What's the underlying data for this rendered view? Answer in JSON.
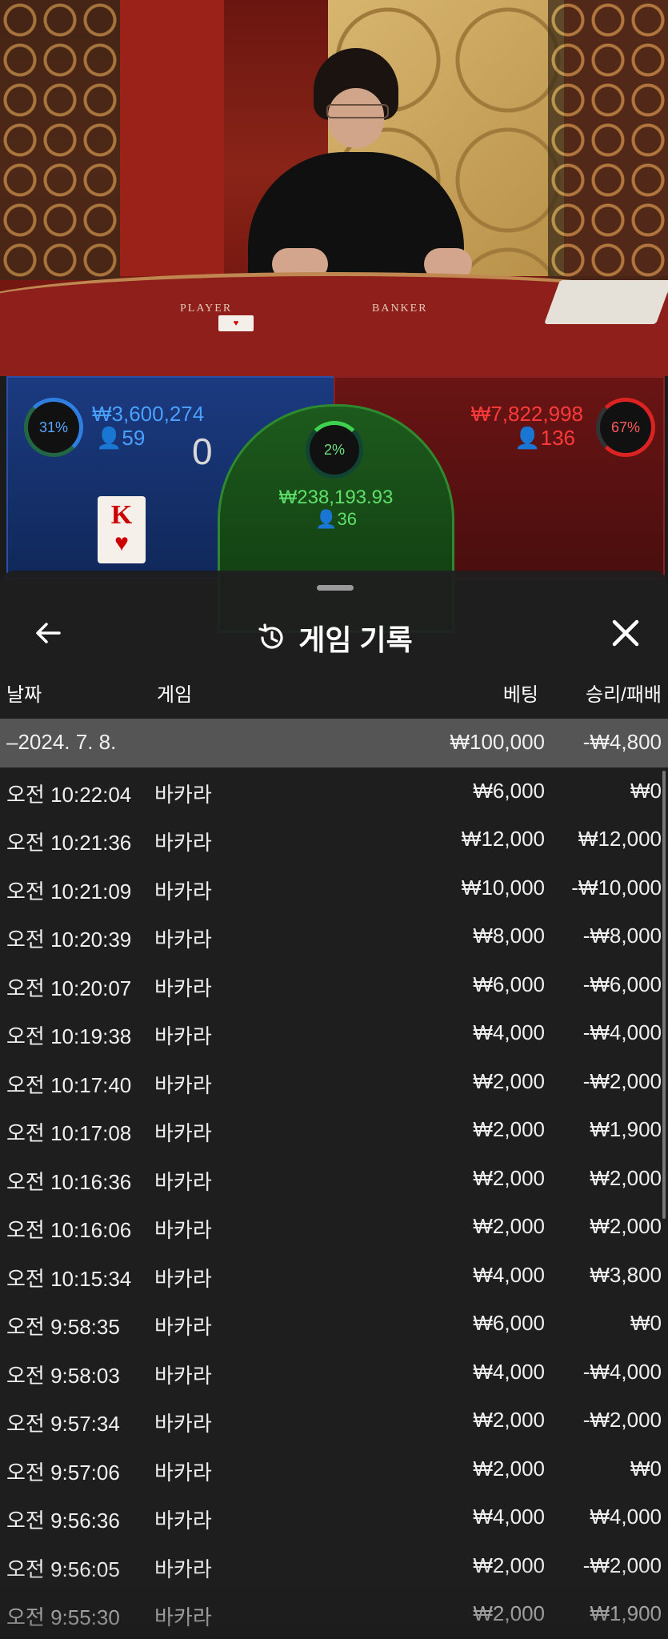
{
  "table": {
    "label_player": "PLAYER",
    "label_banker": "BANKER"
  },
  "player": {
    "percent": "31%",
    "amount": "₩3,600,274",
    "bettors": "59",
    "score": "0",
    "card_rank": "K",
    "card_suit": "♥"
  },
  "tie": {
    "percent": "2%",
    "amount": "₩238,193.93",
    "bettors": "36"
  },
  "banker": {
    "percent": "67%",
    "amount": "₩7,822,998",
    "bettors": "136"
  },
  "sheet": {
    "title": "게임 기록",
    "columns": {
      "date": "날짜",
      "game": "게임",
      "bet": "베팅",
      "win": "승리/패배"
    },
    "summary": {
      "date": "–2024. 7. 8.",
      "bet": "₩100,000",
      "win": "-₩4,800"
    },
    "rows": [
      {
        "date": "오전 10:22:04",
        "game": "바카라",
        "bet": "₩6,000",
        "win": "₩0"
      },
      {
        "date": "오전 10:21:36",
        "game": "바카라",
        "bet": "₩12,000",
        "win": "₩12,000"
      },
      {
        "date": "오전 10:21:09",
        "game": "바카라",
        "bet": "₩10,000",
        "win": "-₩10,000"
      },
      {
        "date": "오전 10:20:39",
        "game": "바카라",
        "bet": "₩8,000",
        "win": "-₩8,000"
      },
      {
        "date": "오전 10:20:07",
        "game": "바카라",
        "bet": "₩6,000",
        "win": "-₩6,000"
      },
      {
        "date": "오전 10:19:38",
        "game": "바카라",
        "bet": "₩4,000",
        "win": "-₩4,000"
      },
      {
        "date": "오전 10:17:40",
        "game": "바카라",
        "bet": "₩2,000",
        "win": "-₩2,000"
      },
      {
        "date": "오전 10:17:08",
        "game": "바카라",
        "bet": "₩2,000",
        "win": "₩1,900"
      },
      {
        "date": "오전 10:16:36",
        "game": "바카라",
        "bet": "₩2,000",
        "win": "₩2,000"
      },
      {
        "date": "오전 10:16:06",
        "game": "바카라",
        "bet": "₩2,000",
        "win": "₩2,000"
      },
      {
        "date": "오전 10:15:34",
        "game": "바카라",
        "bet": "₩4,000",
        "win": "₩3,800"
      },
      {
        "date": "오전 9:58:35",
        "game": "바카라",
        "bet": "₩6,000",
        "win": "₩0"
      },
      {
        "date": "오전 9:58:03",
        "game": "바카라",
        "bet": "₩4,000",
        "win": "-₩4,000"
      },
      {
        "date": "오전 9:57:34",
        "game": "바카라",
        "bet": "₩2,000",
        "win": "-₩2,000"
      },
      {
        "date": "오전 9:57:06",
        "game": "바카라",
        "bet": "₩2,000",
        "win": "₩0"
      },
      {
        "date": "오전 9:56:36",
        "game": "바카라",
        "bet": "₩4,000",
        "win": "₩4,000"
      },
      {
        "date": "오전 9:56:05",
        "game": "바카라",
        "bet": "₩2,000",
        "win": "-₩2,000"
      },
      {
        "date": "오전 9:55:30",
        "game": "바카라",
        "bet": "₩2,000",
        "win": "₩1,900"
      }
    ]
  }
}
